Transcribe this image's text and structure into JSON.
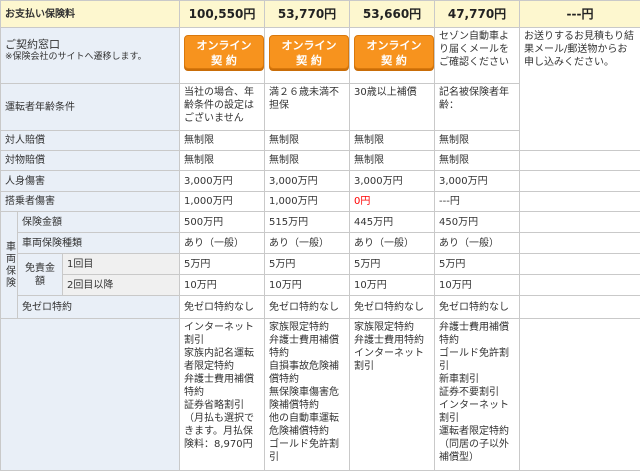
{
  "premium": {
    "label": "お支払い保険料",
    "values": [
      "100,550円",
      "53,770円",
      "53,660円",
      "47,770円",
      "---円"
    ]
  },
  "contract": {
    "label": "ご契約窓口",
    "note": "※保険会社のサイトへ遷移します。",
    "button_line1": "オンライン",
    "button_line2": "契 約",
    "col4_text": "セゾン自動車より届くメールをご確認ください",
    "col5_text": "お送りするお見積もり結果メール/郵送物からお申し込みください。"
  },
  "rows": {
    "driver_age": {
      "label": "運転者年齢条件",
      "values": [
        "当社の場合、年齢条件の設定はございません",
        "満２６歳未満不担保",
        "30歳以上補償",
        "記名被保険者年齢："
      ]
    },
    "bodily": {
      "label": "対人賠償",
      "values": [
        "無制限",
        "無制限",
        "無制限",
        "無制限"
      ]
    },
    "property": {
      "label": "対物賠償",
      "values": [
        "無制限",
        "無制限",
        "無制限",
        "無制限"
      ]
    },
    "personal_injury": {
      "label": "人身傷害",
      "values": [
        "3,000万円",
        "3,000万円",
        "3,000万円",
        "3,000万円"
      ]
    },
    "passenger": {
      "label": "搭乗者傷害",
      "values": [
        "1,000万円",
        "1,000万円",
        "0円",
        "---円"
      ]
    },
    "vehicle_category": "車両保険",
    "insured_amount": {
      "label": "保険金額",
      "values": [
        "500万円",
        "515万円",
        "445万円",
        "450万円"
      ]
    },
    "vehicle_type": {
      "label": "車両保険種類",
      "values": [
        "あり（一般）",
        "あり（一般）",
        "あり（一般）",
        "あり（一般）"
      ]
    },
    "deductible_label": "免責金額",
    "first_time": {
      "label": "1回目",
      "values": [
        "5万円",
        "5万円",
        "5万円",
        "5万円"
      ]
    },
    "second_time": {
      "label": "2回目以降",
      "values": [
        "10万円",
        "10万円",
        "10万円",
        "10万円"
      ]
    },
    "zero_special": {
      "label": "免ゼロ特約",
      "values": [
        "免ゼロ特約なし",
        "免ゼロ特約なし",
        "免ゼロ特約なし",
        "免ゼロ特約なし"
      ]
    }
  },
  "discounts": {
    "col1": [
      "インターネット割引",
      "家族内記名運転者限定特約",
      "弁護士費用補償特約",
      "証券省略割引",
      "（月払も選択できます。月払保険料：8,970円"
    ],
    "col2": [
      "家族限定特約",
      "弁護士費用補償特約",
      "自損事故危険補償特約",
      "無保険車傷害危険補償特約",
      "他の自動車運転危険補償特約",
      "ゴールド免許割引"
    ],
    "col3": [
      "家族限定特約",
      "弁護士費用特約",
      "インターネット割引"
    ],
    "col4": [
      "弁護士費用補償特約",
      "ゴールド免許割引",
      "新車割引",
      "証券不要割引",
      "インターネット割引",
      "運転者限定特約",
      "（同居の子以外補償型）"
    ]
  }
}
